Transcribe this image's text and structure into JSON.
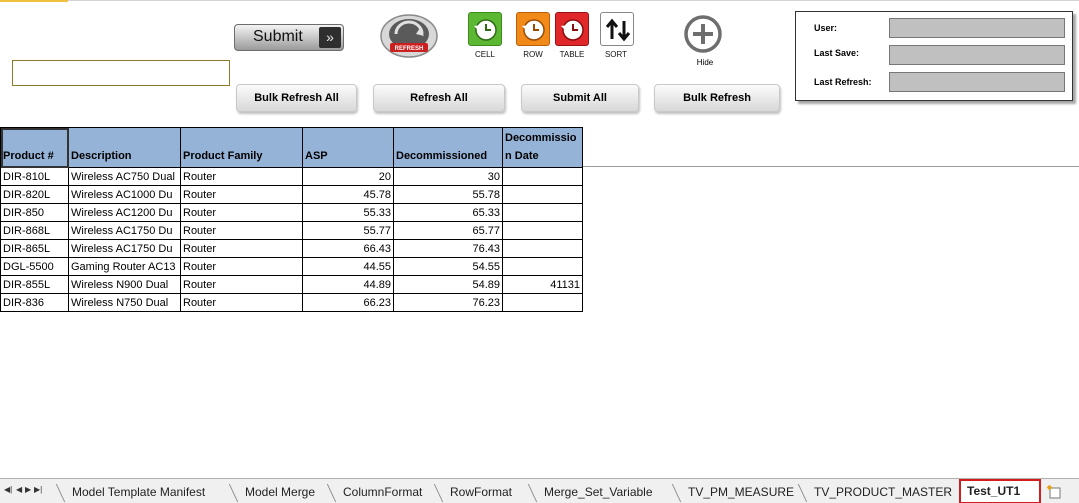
{
  "toolbar": {
    "submit_label": "Submit",
    "submit_arrows": "»",
    "refresh_icon_text": "REFRESH",
    "tools": [
      {
        "caption": "CELL",
        "color": "#5cb832"
      },
      {
        "caption": "ROW",
        "color": "#f28a1a"
      },
      {
        "caption": "TABLE",
        "color": "#e0282a"
      },
      {
        "caption": "SORT",
        "color": "#ffffff"
      }
    ],
    "hide_caption": "Hide",
    "buttons": {
      "bulk_refresh_all": "Bulk Refresh All",
      "refresh_all": "Refresh All",
      "submit_all": "Submit All",
      "bulk_refresh": "Bulk Refresh"
    }
  },
  "info_panel": {
    "user_label": "User:",
    "last_save_label": "Last Save:",
    "last_refresh_label": "Last Refresh:"
  },
  "table": {
    "headers": [
      "Product #",
      "Description",
      "Product Family",
      "ASP",
      "Decommissioned",
      "Decommissio",
      "n Date"
    ],
    "rows": [
      {
        "product": "DIR-810L",
        "desc": "Wireless AC750 Dual",
        "family": "Router",
        "asp": "20",
        "decom": "30",
        "date": ""
      },
      {
        "product": "DIR-820L",
        "desc": "Wireless AC1000 Du",
        "family": "Router",
        "asp": "45.78",
        "decom": "55.78",
        "date": ""
      },
      {
        "product": "DIR-850",
        "desc": "Wireless AC1200 Du",
        "family": "Router",
        "asp": "55.33",
        "decom": "65.33",
        "date": ""
      },
      {
        "product": "DIR-868L",
        "desc": "Wireless AC1750 Du",
        "family": "Router",
        "asp": "55.77",
        "decom": "65.77",
        "date": ""
      },
      {
        "product": "DIR-865L",
        "desc": "Wireless AC1750 Du",
        "family": "Router",
        "asp": "66.43",
        "decom": "76.43",
        "date": ""
      },
      {
        "product": "DGL-5500",
        "desc": "Gaming Router AC13",
        "family": "Router",
        "asp": "44.55",
        "decom": "54.55",
        "date": ""
      },
      {
        "product": "DIR-855L",
        "desc": "Wireless N900 Dual",
        "family": "Router",
        "asp": "44.89",
        "decom": "54.89",
        "date": "41131"
      },
      {
        "product": "DIR-836",
        "desc": "Wireless N750 Dual",
        "family": "Router",
        "asp": "66.23",
        "decom": "76.23",
        "date": ""
      }
    ]
  },
  "sheet_tabs": [
    "Model Template Manifest",
    "Model Merge",
    "ColumnFormat",
    "RowFormat",
    "Merge_Set_Variable",
    "TV_PM_MEASURE",
    "TV_PRODUCT_MASTER",
    "Test_UT1"
  ],
  "active_tab": "Test_UT1",
  "colors": {
    "header_fill": "#95b3d7",
    "active_tab_border": "#d21e1e"
  }
}
